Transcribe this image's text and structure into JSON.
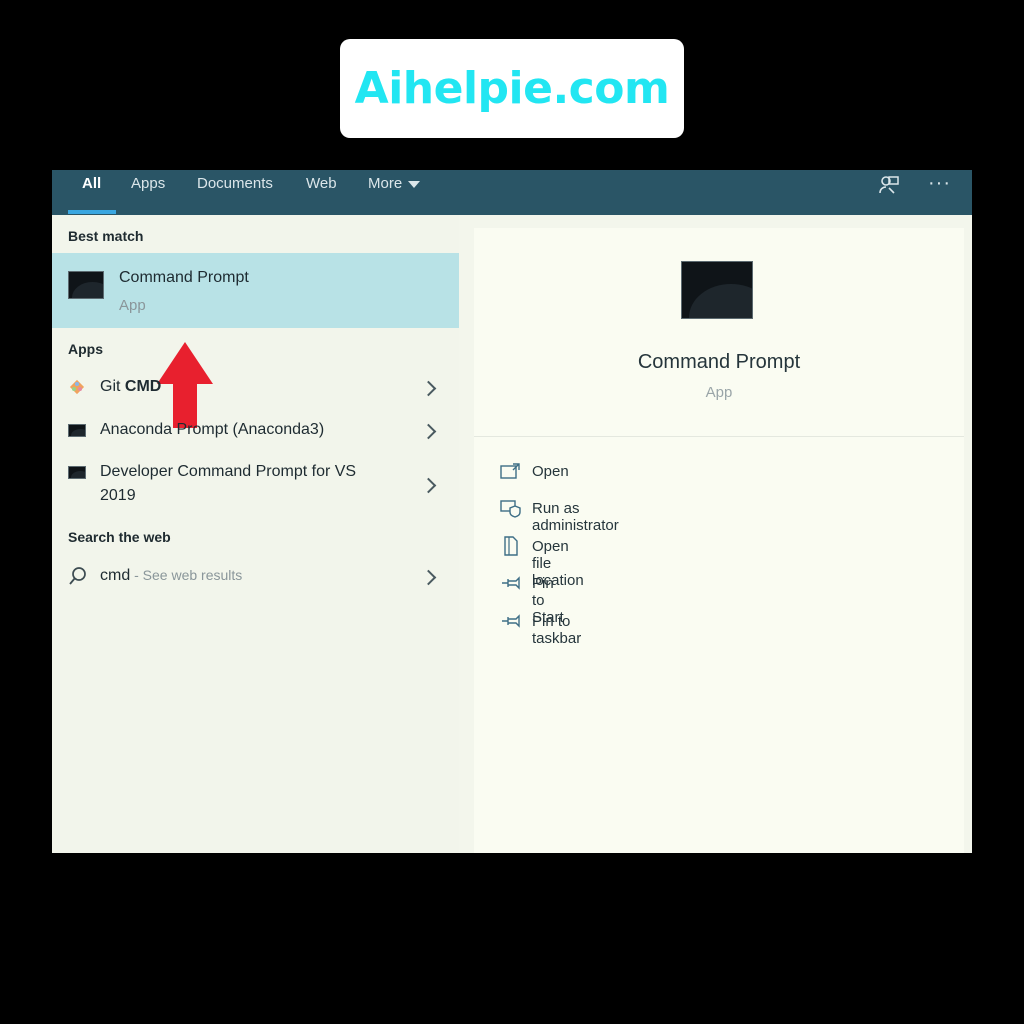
{
  "brand": {
    "text": "Aihelpie.com"
  },
  "tabs": [
    {
      "label": "All"
    },
    {
      "label": "Apps"
    },
    {
      "label": "Documents"
    },
    {
      "label": "Web"
    },
    {
      "label": "More"
    }
  ],
  "top_icons": [
    "feedback-icon",
    "more-options-icon"
  ],
  "left": {
    "best_match_header": "Best match",
    "best_match": {
      "title": "Command Prompt",
      "subtitle": "App"
    },
    "apps_header": "Apps",
    "apps": [
      {
        "name_plain": "Git ",
        "name_bold": "CMD",
        "icon": "git-icon"
      },
      {
        "name": "Anaconda Prompt (Anaconda3)",
        "icon": "anaconda-prompt-icon"
      },
      {
        "line1": "Developer Command Prompt for VS",
        "line2": "2019",
        "icon": "terminal-icon"
      }
    ],
    "web_header": "Search the web",
    "web": {
      "query": "cmd",
      "suffix": " - See web results",
      "icon": "search-icon"
    }
  },
  "right": {
    "title": "Command Prompt",
    "subtitle": "App",
    "actions": [
      {
        "label": "Open",
        "icon": "open-icon"
      },
      {
        "label": "Run as administrator",
        "icon": "admin-shield-icon"
      },
      {
        "label": "Open file location",
        "icon": "file-location-icon"
      },
      {
        "label": "Pin to Start",
        "icon": "pin-icon"
      },
      {
        "label": "Pin to taskbar",
        "icon": "pin-icon"
      }
    ]
  },
  "colors": {
    "topbar": "#2a5566",
    "selected_row": "#b8e2e6",
    "accent": "#3aa6e0",
    "brand_text": "#22e6f2",
    "arrow": "#e8202e"
  }
}
